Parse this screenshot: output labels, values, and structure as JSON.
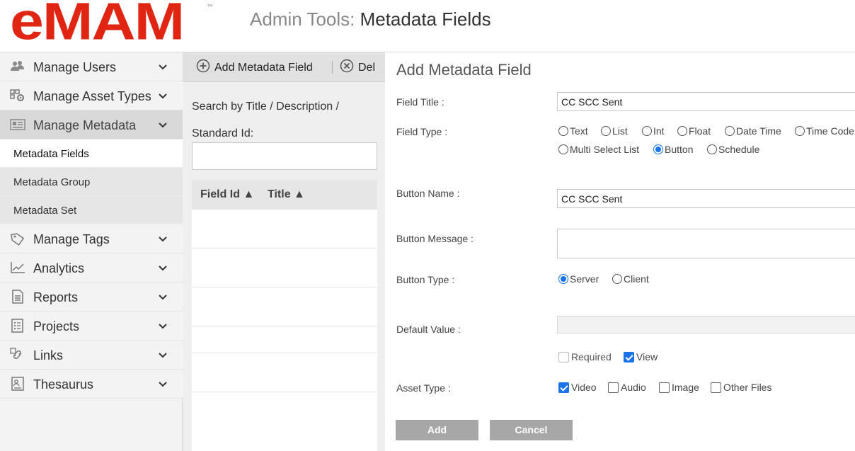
{
  "header": {
    "logo_text": "eMAM",
    "trademark": "™",
    "title_prefix": "Admin Tools: ",
    "title_main": "Metadata Fields"
  },
  "sidebar": {
    "items": [
      {
        "label": "Manage Users",
        "icon": "users-icon"
      },
      {
        "label": "Manage Asset Types",
        "icon": "asset-types-icon"
      },
      {
        "label": "Manage Metadata",
        "icon": "metadata-icon"
      },
      {
        "label": "Manage Tags",
        "icon": "tag-icon"
      },
      {
        "label": "Analytics",
        "icon": "analytics-icon"
      },
      {
        "label": "Reports",
        "icon": "report-icon"
      },
      {
        "label": "Projects",
        "icon": "projects-icon"
      },
      {
        "label": "Links",
        "icon": "link-icon"
      },
      {
        "label": "Thesaurus",
        "icon": "thesaurus-icon"
      }
    ],
    "sub_items": [
      {
        "label": "Metadata Fields"
      },
      {
        "label": "Metadata Group"
      },
      {
        "label": "Metadata Set"
      }
    ]
  },
  "middle": {
    "add_label": "Add Metadata Field",
    "delete_label": "Del",
    "search_label": "Search by Title / Description / Standard Id:",
    "search_value": "",
    "col_field_id": "Field Id ▲",
    "col_title": "Title ▲"
  },
  "form": {
    "title": "Add Metadata Field",
    "field_title_label": "Field Title :",
    "field_title_value": "CC SCC Sent",
    "field_type_label": "Field Type :",
    "field_types": [
      "Text",
      "List",
      "Int",
      "Float",
      "Date Time",
      "Time Code",
      "Multi Select List",
      "Button",
      "Schedule"
    ],
    "field_type_selected": "Button",
    "button_name_label": "Button Name :",
    "button_name_value": "CC SCC Sent",
    "button_message_label": "Button Message :",
    "button_message_value": "",
    "button_type_label": "Button Type :",
    "button_types": [
      "Server",
      "Client"
    ],
    "button_type_selected": "Server",
    "default_value_label": "Default Value :",
    "default_value": "",
    "required_label": "Required",
    "required_checked": false,
    "view_label": "View",
    "view_checked": true,
    "asset_type_label": "Asset Type :",
    "asset_types": [
      {
        "label": "Video",
        "checked": true
      },
      {
        "label": "Audio",
        "checked": false
      },
      {
        "label": "Image",
        "checked": false
      },
      {
        "label": "Other Files",
        "checked": false
      }
    ],
    "add_button": "Add",
    "cancel_button": "Cancel"
  },
  "colors": {
    "brand": "#e02613",
    "accent": "#1a73e8",
    "button_gray": "#a7a7a7"
  }
}
